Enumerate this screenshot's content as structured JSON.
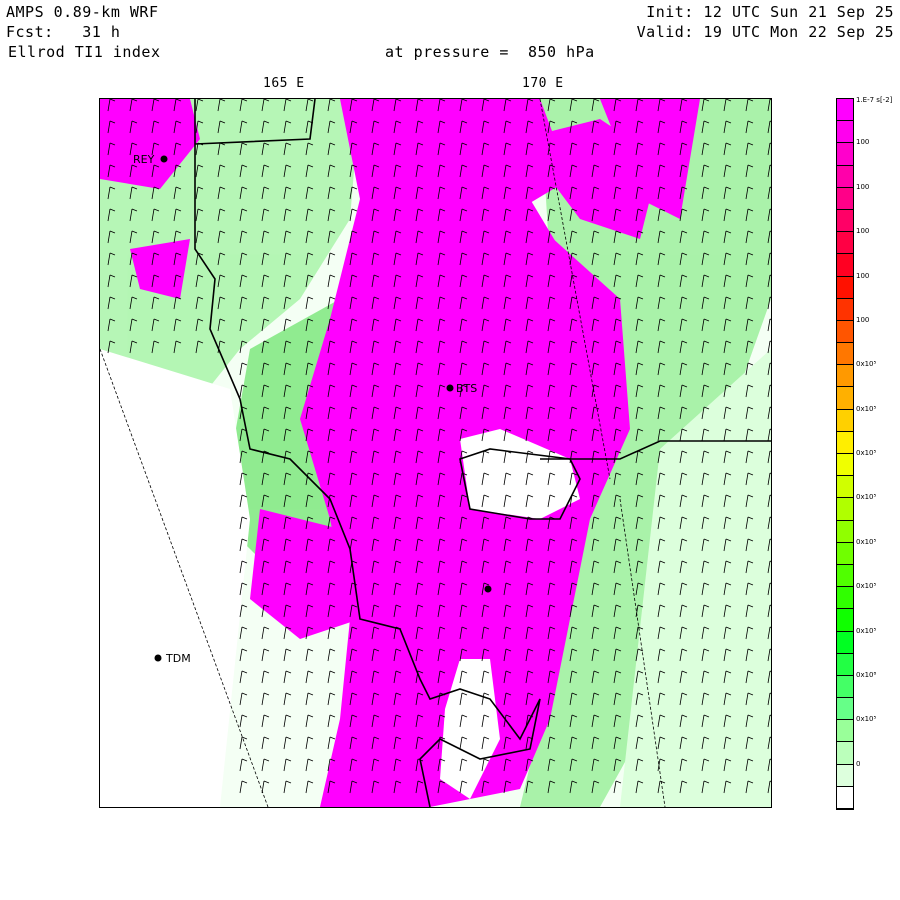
{
  "header": {
    "model": "AMPS 0.89-km WRF",
    "forecast": "Fcst:   31 h",
    "field": "Ellrod TI1 index",
    "init": "Init: 12 UTC Sun 21 Sep 25",
    "valid": "Valid: 19 UTC Mon 22 Sep 25",
    "level": "at pressure =  850 hPa"
  },
  "axis": {
    "lon_labels": [
      "165 E",
      "170 E"
    ]
  },
  "stations": [
    {
      "label": "REY"
    },
    {
      "label": "BTS"
    },
    {
      "label": ""
    },
    {
      "label": "TDM"
    }
  ],
  "colorbar": {
    "unit_label": "1.E-7 s[-2]",
    "labels": [
      "100",
      "100",
      "100",
      "100",
      "100",
      "0x10⁵",
      "0x10⁵",
      "0x10⁵",
      "0x10⁵",
      "0x10⁵",
      "0x10⁵",
      "0x10⁵",
      "0x10⁸",
      "0x10⁵",
      "0"
    ],
    "colors": [
      "#ff00ff",
      "#ff00ee",
      "#ff00cc",
      "#ff00aa",
      "#ff0088",
      "#ff0066",
      "#ff0044",
      "#ff0022",
      "#ff1100",
      "#ff3300",
      "#ff5500",
      "#ff7700",
      "#ff9900",
      "#ffb000",
      "#ffd000",
      "#ffee00",
      "#f0ff00",
      "#d0ff00",
      "#b0ff00",
      "#90ff00",
      "#70ff00",
      "#50ff00",
      "#30ff00",
      "#10ff00",
      "#00ff22",
      "#22ff44",
      "#44ff66",
      "#66ff88",
      "#99ff99",
      "#bbffbb",
      "#ddffdd",
      "#ffffff"
    ]
  },
  "colors": {
    "high": "#ff00ff",
    "mid": "#00ff22",
    "low": "#ffffff"
  }
}
